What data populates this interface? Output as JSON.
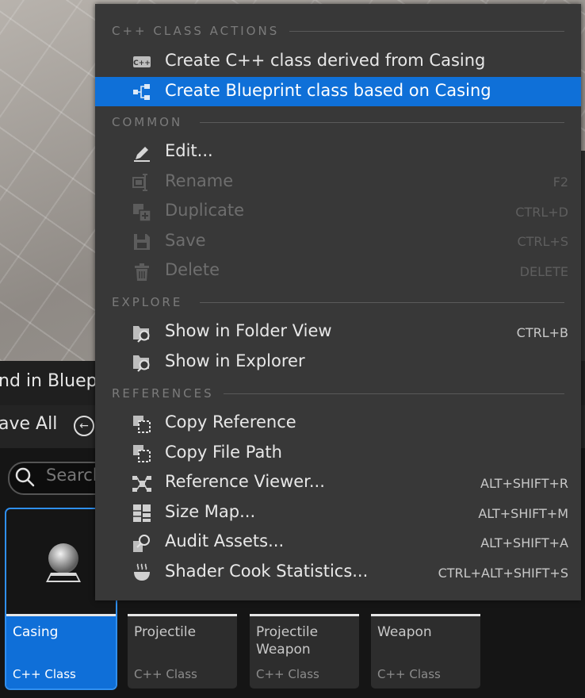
{
  "background": {
    "header_title": "nd in Blueprint",
    "save_all": "ave All",
    "search_placeholder": "Search",
    "tiles": [
      {
        "name": "Casing",
        "type": "C++ Class",
        "selected": true
      },
      {
        "name": "Projectile",
        "type": "C++ Class",
        "selected": false
      },
      {
        "name": "Projectile Weapon",
        "type": "C++ Class",
        "selected": false
      },
      {
        "name": "Weapon",
        "type": "C++ Class",
        "selected": false
      }
    ]
  },
  "menu": {
    "sections": {
      "cpp": "C++ CLASS ACTIONS",
      "common": "COMMON",
      "explore": "EXPLORE",
      "references": "REFERENCES"
    },
    "items": {
      "create_cpp": {
        "label": "Create C++ class derived from Casing",
        "icon": "cpp-class-icon"
      },
      "create_bp": {
        "label": "Create Blueprint class based on Casing",
        "icon": "blueprint-class-icon"
      },
      "edit": {
        "label": "Edit...",
        "icon": "pencil-icon"
      },
      "rename": {
        "label": "Rename",
        "shortcut": "F2",
        "icon": "rename-icon"
      },
      "duplicate": {
        "label": "Duplicate",
        "shortcut": "CTRL+D",
        "icon": "duplicate-icon"
      },
      "save": {
        "label": "Save",
        "shortcut": "CTRL+S",
        "icon": "save-icon"
      },
      "delete": {
        "label": "Delete",
        "shortcut": "DELETE",
        "icon": "trash-icon"
      },
      "show_folder": {
        "label": "Show in Folder View",
        "shortcut": "CTRL+B",
        "icon": "folder-search-icon"
      },
      "show_explorer": {
        "label": "Show in Explorer",
        "icon": "folder-search-icon"
      },
      "copy_ref": {
        "label": "Copy Reference",
        "icon": "copy-reference-icon"
      },
      "copy_path": {
        "label": "Copy File Path",
        "icon": "copy-path-icon"
      },
      "ref_viewer": {
        "label": "Reference Viewer...",
        "shortcut": "ALT+SHIFT+R",
        "icon": "reference-viewer-icon"
      },
      "size_map": {
        "label": "Size Map...",
        "shortcut": "ALT+SHIFT+M",
        "icon": "size-map-icon"
      },
      "audit": {
        "label": "Audit Assets...",
        "shortcut": "ALT+SHIFT+A",
        "icon": "audit-icon"
      },
      "shader": {
        "label": "Shader Cook Statistics...",
        "shortcut": "CTRL+ALT+SHIFT+S",
        "icon": "shader-icon"
      }
    }
  },
  "colors": {
    "highlight": "#0f70d8",
    "menu_bg": "#383838"
  }
}
